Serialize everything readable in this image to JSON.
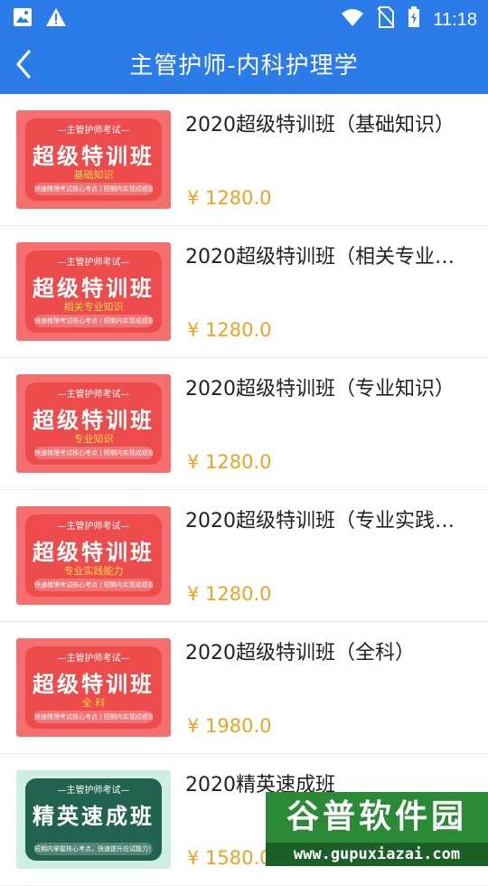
{
  "status_bar": {
    "time": "11:18",
    "icons": [
      "image-icon",
      "warning-icon",
      "wifi-icon",
      "no-sim-icon",
      "battery-charging-icon"
    ]
  },
  "header": {
    "title": "主管护师-内科护理学",
    "back_icon": "chevron-left-icon"
  },
  "colors": {
    "accent": "#2b7be9",
    "price": "#f0a323",
    "thumb_red": "#ee4c4c",
    "thumb_green": "#21634f"
  },
  "courses": [
    {
      "title": "2020超级特训班（基础知识）",
      "price": "¥ 1280.0",
      "thumb": {
        "top": "—主管护师考试—",
        "main": "超级特训班",
        "sub": "基础知识",
        "bar": "快速梳理考试核心考点 | 短期内实现成绩提升"
      }
    },
    {
      "title": "2020超级特训班（相关专业…",
      "price": "¥ 1280.0",
      "thumb": {
        "top": "—主管护师考试—",
        "main": "超级特训班",
        "sub": "相关专业知识",
        "bar": "快速梳理考试核心考点 | 短期内实现成绩提升"
      }
    },
    {
      "title": "2020超级特训班（专业知识）",
      "price": "¥ 1280.0",
      "thumb": {
        "top": "—主管护师考试—",
        "main": "超级特训班",
        "sub": "专业知识",
        "bar": "快速梳理考试核心考点 | 短期内实现成绩提升"
      }
    },
    {
      "title": "2020超级特训班（专业实践…",
      "price": "¥ 1280.0",
      "thumb": {
        "top": "—主管护师考试—",
        "main": "超级特训班",
        "sub": "专业实践能力",
        "bar": "快速梳理考试核心考点 | 短期内实现成绩提升"
      }
    },
    {
      "title": "2020超级特训班（全科）",
      "price": "¥ 1980.0",
      "thumb": {
        "top": "—主管护师考试—",
        "main": "超级特训班",
        "sub": "全 科",
        "bar": "快速梳理考试核心考点 | 短期内实现成绩提升"
      }
    },
    {
      "title": "2020精英速成班",
      "price": "¥ 1580.0",
      "thumb": {
        "top": "—主管护师考试—",
        "main": "精英速成班",
        "sub": "",
        "bar": "短期内掌握核心考点，快速提升应试能力！"
      }
    }
  ],
  "watermark": {
    "main": "谷普软件园",
    "url": "www.gupuxiazai.com"
  }
}
